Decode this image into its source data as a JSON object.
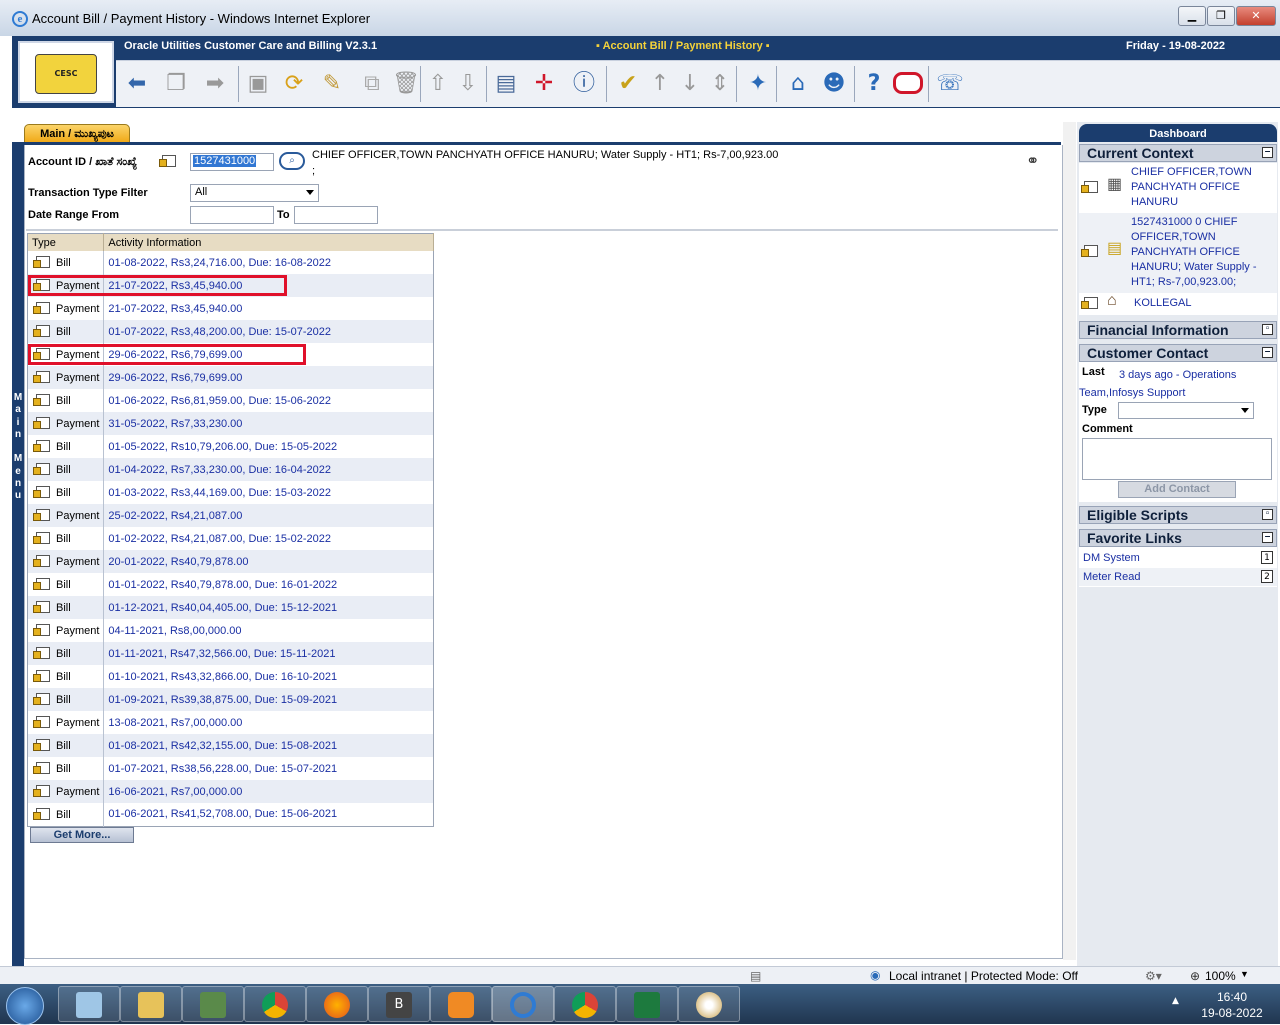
{
  "window": {
    "title": "Account Bill / Payment History - Windows Internet Explorer"
  },
  "header": {
    "app_name": "Oracle Utilities Customer Care and Billing V2.3.1",
    "page_title": "Account Bill / Payment History",
    "date": "Friday - 19-08-2022"
  },
  "main": {
    "tab_label": "Main / ಮುಖ್ಯಪುಟ",
    "menu_label": "Main Menu",
    "account_label": "Account ID / ಖಾತೆ ಸಂಖ್ಯೆ",
    "account_id": "1527431000",
    "account_info": "CHIEF OFFICER,TOWN PANCHYATH OFFICE HANURU; Water Supply - HT1; Rs-7,00,923.00 ;",
    "txn_filter_label": "Transaction Type Filter",
    "txn_filter_value": "All",
    "date_range_label": "Date Range From",
    "to_label": "To",
    "date_from": "",
    "date_to": "",
    "get_more": "Get More..."
  },
  "table": {
    "headers": [
      "Type",
      "Activity Information"
    ],
    "rows": [
      {
        "type": "Bill",
        "info": "01-08-2022, Rs3,24,716.00, Due: 16-08-2022",
        "highlight": false
      },
      {
        "type": "Payment",
        "info": "21-07-2022, Rs3,45,940.00",
        "highlight": true
      },
      {
        "type": "Payment",
        "info": "21-07-2022, Rs3,45,940.00",
        "highlight": false
      },
      {
        "type": "Bill",
        "info": "01-07-2022, Rs3,48,200.00, Due: 15-07-2022",
        "highlight": false
      },
      {
        "type": "Payment",
        "info": "29-06-2022, Rs6,79,699.00",
        "highlight": true
      },
      {
        "type": "Payment",
        "info": "29-06-2022, Rs6,79,699.00",
        "highlight": false
      },
      {
        "type": "Bill",
        "info": "01-06-2022, Rs6,81,959.00, Due: 15-06-2022",
        "highlight": false
      },
      {
        "type": "Payment",
        "info": "31-05-2022, Rs7,33,230.00",
        "highlight": false
      },
      {
        "type": "Bill",
        "info": "01-05-2022, Rs10,79,206.00, Due: 15-05-2022",
        "highlight": false
      },
      {
        "type": "Bill",
        "info": "01-04-2022, Rs7,33,230.00, Due: 16-04-2022",
        "highlight": false
      },
      {
        "type": "Bill",
        "info": "01-03-2022, Rs3,44,169.00, Due: 15-03-2022",
        "highlight": false
      },
      {
        "type": "Payment",
        "info": "25-02-2022, Rs4,21,087.00",
        "highlight": false
      },
      {
        "type": "Bill",
        "info": "01-02-2022, Rs4,21,087.00, Due: 15-02-2022",
        "highlight": false
      },
      {
        "type": "Payment",
        "info": "20-01-2022, Rs40,79,878.00",
        "highlight": false
      },
      {
        "type": "Bill",
        "info": "01-01-2022, Rs40,79,878.00, Due: 16-01-2022",
        "highlight": false
      },
      {
        "type": "Bill",
        "info": "01-12-2021, Rs40,04,405.00, Due: 15-12-2021",
        "highlight": false
      },
      {
        "type": "Payment",
        "info": "04-11-2021, Rs8,00,000.00",
        "highlight": false
      },
      {
        "type": "Bill",
        "info": "01-11-2021, Rs47,32,566.00, Due: 15-11-2021",
        "highlight": false
      },
      {
        "type": "Bill",
        "info": "01-10-2021, Rs43,32,866.00, Due: 16-10-2021",
        "highlight": false
      },
      {
        "type": "Bill",
        "info": "01-09-2021, Rs39,38,875.00, Due: 15-09-2021",
        "highlight": false
      },
      {
        "type": "Payment",
        "info": "13-08-2021, Rs7,00,000.00",
        "highlight": false
      },
      {
        "type": "Bill",
        "info": "01-08-2021, Rs42,32,155.00, Due: 15-08-2021",
        "highlight": false
      },
      {
        "type": "Bill",
        "info": "01-07-2021, Rs38,56,228.00, Due: 15-07-2021",
        "highlight": false
      },
      {
        "type": "Payment",
        "info": "16-06-2021, Rs7,00,000.00",
        "highlight": false
      },
      {
        "type": "Bill",
        "info": "01-06-2021, Rs41,52,708.00, Due: 15-06-2021",
        "highlight": false
      }
    ]
  },
  "dashboard": {
    "title": "Dashboard",
    "current_context": "Current Context",
    "ctx_person": "CHIEF OFFICER,TOWN PANCHYATH OFFICE HANURU",
    "ctx_account": "1527431000 0 CHIEF OFFICER,TOWN PANCHYATH OFFICE HANURU; Water Supply - HT1; Rs-7,00,923.00;",
    "ctx_premise": "KOLLEGAL",
    "financial_information": "Financial Information",
    "customer_contact": "Customer Contact",
    "last_label": "Last",
    "last_value": "3 days ago - Operations Team,Infosys Support",
    "type_label": "Type",
    "comment_label": "Comment",
    "add_contact": "Add Contact",
    "eligible_scripts": "Eligible Scripts",
    "favorite_links": "Favorite Links",
    "links": [
      {
        "label": "DM System",
        "key": "1"
      },
      {
        "label": "Meter Read",
        "key": "2"
      }
    ]
  },
  "statusbar": {
    "zone": "Local intranet | Protected Mode: Off",
    "zoom": "100%"
  },
  "taskbar": {
    "b_label": "B",
    "time": "16:40",
    "date": "19-08-2022"
  },
  "colors": {
    "header_bg": "#1b3d6e",
    "tab_bg": "#f0a713",
    "highlight_box": "#e0102a",
    "link": "#1a2fa3"
  }
}
